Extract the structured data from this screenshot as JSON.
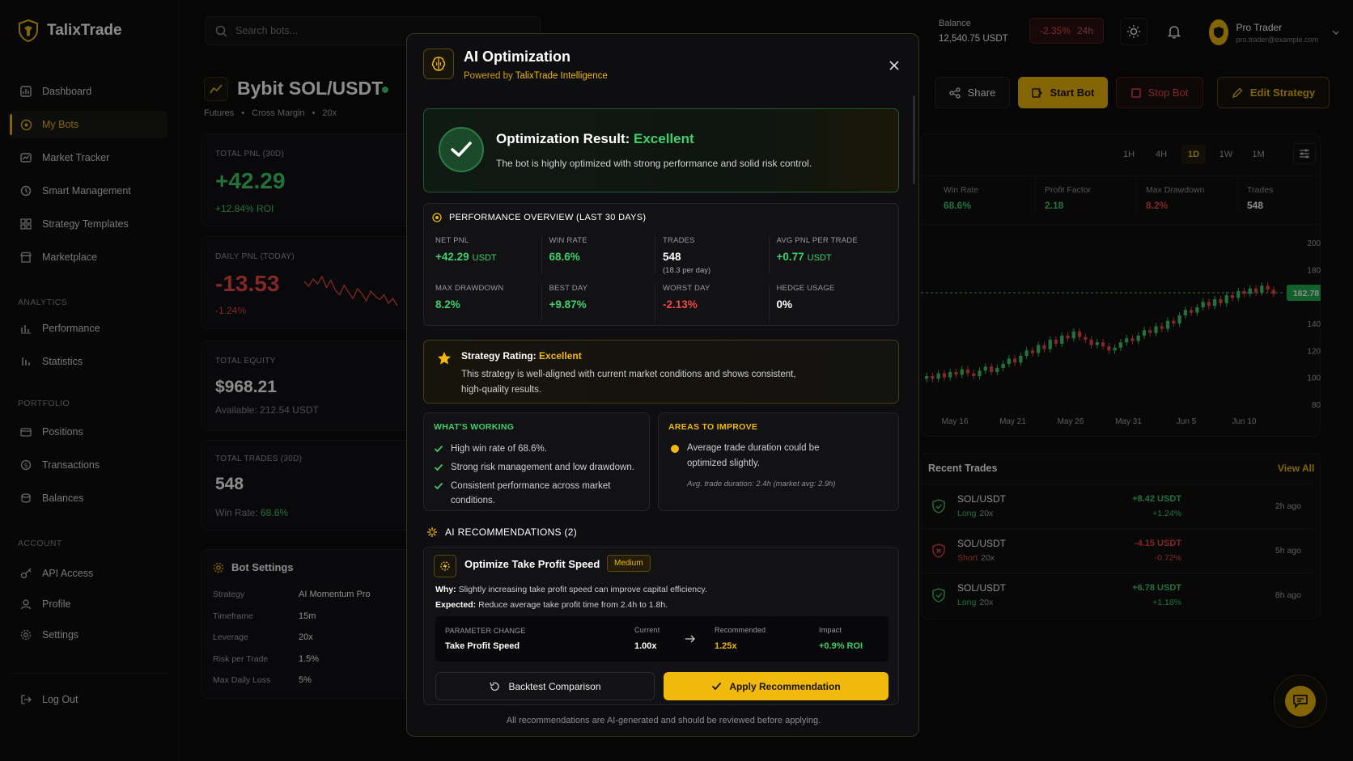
{
  "app": {
    "name": "TalixTrade"
  },
  "sidebar": {
    "items": [
      {
        "label": "Dashboard",
        "icon": "dashboard-icon"
      },
      {
        "label": "My Bots",
        "icon": "bot-icon",
        "active": true
      },
      {
        "label": "Market Tracker",
        "icon": "market-tracker-icon"
      },
      {
        "label": "Smart Management",
        "icon": "smart-management-icon"
      },
      {
        "label": "Strategy Templates",
        "icon": "strategy-templates-icon"
      },
      {
        "label": "Marketplace",
        "icon": "marketplace-icon"
      }
    ],
    "analytics_title": "ANALYTICS",
    "analytics": [
      {
        "label": "Performance"
      },
      {
        "label": "Statistics"
      }
    ],
    "portfolio_title": "PORTFOLIO",
    "portfolio": [
      {
        "label": "Positions"
      },
      {
        "label": "Transactions"
      },
      {
        "label": "Balances"
      }
    ],
    "account_title": "ACCOUNT",
    "account": [
      {
        "label": "API Access"
      },
      {
        "label": "Profile"
      },
      {
        "label": "Settings"
      }
    ],
    "logout": "Log Out"
  },
  "header": {
    "search_placeholder": "Search bots...",
    "balance_label": "Balance",
    "balance_value": "12,540.75 USDT",
    "change_value": "-2.35%",
    "change_period": "24h",
    "user_name": "Pro Trader",
    "user_email": "pro.trader@example.com"
  },
  "bot": {
    "title": "Bybit SOL/USDT",
    "meta": [
      "Futures",
      "Cross Margin",
      "20x"
    ]
  },
  "cards": {
    "total_pnl": {
      "label": "TOTAL PNL (30D)",
      "value": "+42.29",
      "sub": "+12.84% ROI"
    },
    "daily_pnl": {
      "label": "DAILY PNL (TODAY)",
      "value": "-13.53",
      "sub": "-1.24%",
      "spark": [
        30,
        38,
        26,
        34,
        22,
        40,
        28,
        44,
        52,
        36,
        48,
        58,
        42,
        50,
        62,
        46,
        54,
        60,
        52,
        66,
        58,
        70
      ]
    },
    "total_equity": {
      "label": "TOTAL EQUITY",
      "value": "$968.21",
      "sub": "Available: 212.54 USDT"
    },
    "total_trades": {
      "label": "TOTAL TRADES (30D)",
      "value": "548",
      "sub_prefix": "Win Rate:",
      "sub_value": "68.6%"
    }
  },
  "settings_card": {
    "title": "Bot Settings",
    "rows": [
      {
        "label": "Strategy",
        "value": "AI Momentum Pro"
      },
      {
        "label": "Timeframe",
        "value": "15m"
      },
      {
        "label": "Leverage",
        "value": "20x"
      },
      {
        "label": "Risk per Trade",
        "value": "1.5%"
      },
      {
        "label": "Max Daily Loss",
        "value": "5%"
      }
    ]
  },
  "modal": {
    "title": "AI Optimization",
    "subtitle_prefix": "Powered by",
    "subtitle_brand": "TalixTrade Intelligence",
    "result_title": "Optimization Result:",
    "result_grade": "Excellent",
    "result_text": "The bot is highly optimized with strong performance and solid risk control.",
    "overview_title": "PERFORMANCE OVERVIEW (LAST 30 DAYS)",
    "metrics": [
      {
        "label": "NET PNL",
        "value": "+42.29",
        "unit": "USDT",
        "tone": "green"
      },
      {
        "label": "WIN RATE",
        "value": "68.6%",
        "unit": "",
        "tone": "green"
      },
      {
        "label": "TRADES",
        "value": "548",
        "unit": "",
        "tone": "white",
        "note": "(18.3 per day)"
      },
      {
        "label": "AVG PNL PER TRADE",
        "value": "+0.77",
        "unit": "USDT",
        "tone": "green"
      },
      {
        "label": "MAX DRAWDOWN",
        "value": "8.2%",
        "unit": "",
        "tone": "green"
      },
      {
        "label": "BEST DAY",
        "value": "+9.87%",
        "unit": "",
        "tone": "green"
      },
      {
        "label": "WORST DAY",
        "value": "-2.13%",
        "unit": "",
        "tone": "red"
      },
      {
        "label": "HEDGE USAGE",
        "value": "0%",
        "unit": "",
        "tone": "white"
      }
    ],
    "rating_label": "Strategy Rating:",
    "rating_value": "Excellent",
    "rating_text": "This strategy is well-aligned with current market conditions and shows consistent, high-quality results.",
    "working_title": "WHAT'S WORKING",
    "working": [
      "High win rate of 68.6%.",
      "Strong risk management and low drawdown.",
      "Consistent performance across market conditions."
    ],
    "improve_title": "AREAS TO IMPROVE",
    "improve_text": "Average trade duration could be optimized slightly.",
    "improve_note": "Avg. trade duration: 2.4h (market avg: 2.9h)",
    "recs_title": "AI RECOMMENDATIONS (2)",
    "rec": {
      "title": "Optimize Take Profit Speed",
      "badge": "Medium",
      "why_label": "Why:",
      "why_text": "Slightly increasing take profit speed can improve capital efficiency.",
      "expected_label": "Expected:",
      "expected_text": "Reduce average take profit time from 2.4h to 1.8h.",
      "param_header": "PARAMETER CHANGE",
      "param_name": "Take Profit Speed",
      "current_label": "Current",
      "current_value": "1.00x",
      "recommended_label": "Recommended",
      "recommended_value": "1.25x",
      "impact_label": "Impact",
      "impact_value": "+0.9% ROI"
    },
    "backtest_btn": "Backtest Comparison",
    "apply_btn": "Apply Recommendation",
    "footer": "All recommendations are AI-generated and should be reviewed before applying."
  },
  "actions": {
    "share": "Share",
    "start": "Start Bot",
    "stop": "Stop Bot",
    "edit": "Edit Strategy"
  },
  "timeframes": [
    "1H",
    "4H",
    "1D",
    "1W",
    "1M"
  ],
  "active_timeframe": "1D",
  "stats": [
    {
      "label": "Win Rate",
      "value": "68.6%",
      "tone": "green"
    },
    {
      "label": "Profit Factor",
      "value": "2.18",
      "tone": "green"
    },
    {
      "label": "Max Drawdown",
      "value": "8.2%",
      "tone": "red"
    },
    {
      "label": "Trades",
      "value": "548",
      "tone": "white"
    }
  ],
  "chart_data": {
    "type": "candlestick",
    "y_ticks": [
      "200.00",
      "180.00",
      "140.00",
      "120.00",
      "100.00",
      "80.00"
    ],
    "x_ticks": [
      "May 16",
      "May 21",
      "May 26",
      "May 31",
      "Jun 5",
      "Jun 10"
    ],
    "ylim": [
      80,
      200
    ],
    "current_price": "162.78",
    "closes": [
      101,
      99,
      103,
      100,
      104,
      102,
      106,
      103,
      101,
      105,
      108,
      104,
      107,
      110,
      114,
      111,
      116,
      120,
      118,
      124,
      121,
      128,
      125,
      131,
      129,
      134,
      130,
      128,
      124,
      126,
      123,
      120,
      122,
      126,
      129,
      127,
      131,
      135,
      133,
      138,
      136,
      142,
      140,
      146,
      150,
      148,
      152,
      156,
      153,
      158,
      155,
      161,
      159,
      164,
      162,
      166,
      163,
      168,
      165,
      162
    ]
  },
  "recent_trades": {
    "title": "Recent Trades",
    "view_all": "View All",
    "rows": [
      {
        "pair": "SOL/USDT",
        "side": "Long",
        "lev": "20x",
        "pnl": "+8.42 USDT",
        "pct": "+1.24%",
        "time": "2h ago",
        "tone": "green"
      },
      {
        "pair": "SOL/USDT",
        "side": "Short",
        "lev": "20x",
        "pnl": "-4.15 USDT",
        "pct": "-0.72%",
        "time": "5h ago",
        "tone": "red"
      },
      {
        "pair": "SOL/USDT",
        "side": "Long",
        "lev": "20x",
        "pnl": "+6.78 USDT",
        "pct": "+1.18%",
        "time": "8h ago",
        "tone": "green"
      }
    ]
  },
  "colors": {
    "accent": "#f0b90b",
    "green": "#3fcf6b",
    "red": "#ef4848",
    "bg": "#0b0b0c"
  }
}
